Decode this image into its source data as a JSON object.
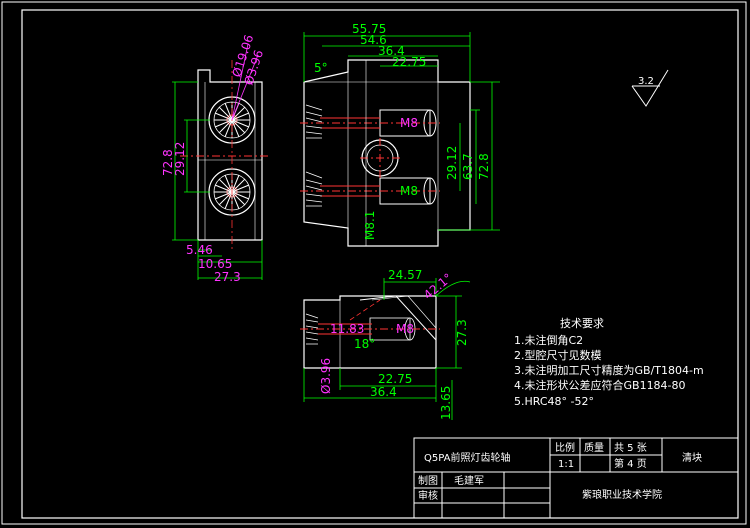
{
  "drawing": {
    "title_block": {
      "part_name": "Q5PA前照灯齿轮轴",
      "h_scale": "比例",
      "h_qty": "质量",
      "sheets_total": "共 5 张",
      "sheet_no": "第 4 页",
      "scale": "1:1",
      "material": "清块",
      "drawn_label": "制图",
      "drawn_by": "毛建军",
      "check_label": "审核",
      "school": "紫琅职业技术学院"
    },
    "tech_req": {
      "title": "技术要求",
      "items": [
        "1.未注倒角C2",
        "2.型腔尺寸见数模",
        "3.未注明加工尺寸精度为GB/T1804-m",
        "4.未注形状公差应符合GB1184-80",
        "5.HRC48° -52°"
      ]
    },
    "roughness": "3.2",
    "dims": {
      "left_view": {
        "d1": "Ø19.06",
        "d2": "Ø3.96",
        "h_total": "72.8",
        "h_center": "29.12",
        "w1": "5.46",
        "w2": "10.65",
        "w3": "27.3"
      },
      "front_view": {
        "w_total": "55.75",
        "w2": "54.6",
        "w3": "36.4",
        "w4": "22.75",
        "angle": "5°",
        "r1": "29.12",
        "r2": "63.7",
        "r3": "72.8",
        "m_label": "M8",
        "m_label2": "M8",
        "m_note": "M8.1"
      },
      "bottom_view": {
        "top": "24.57",
        "angle": "42.1°",
        "h": "27.3",
        "d": "Ø3.96",
        "w1": "22.75",
        "w2": "36.4",
        "w3": "13.65",
        "inner": "11.83",
        "angle2": "18°",
        "m_label": "M8"
      }
    }
  }
}
